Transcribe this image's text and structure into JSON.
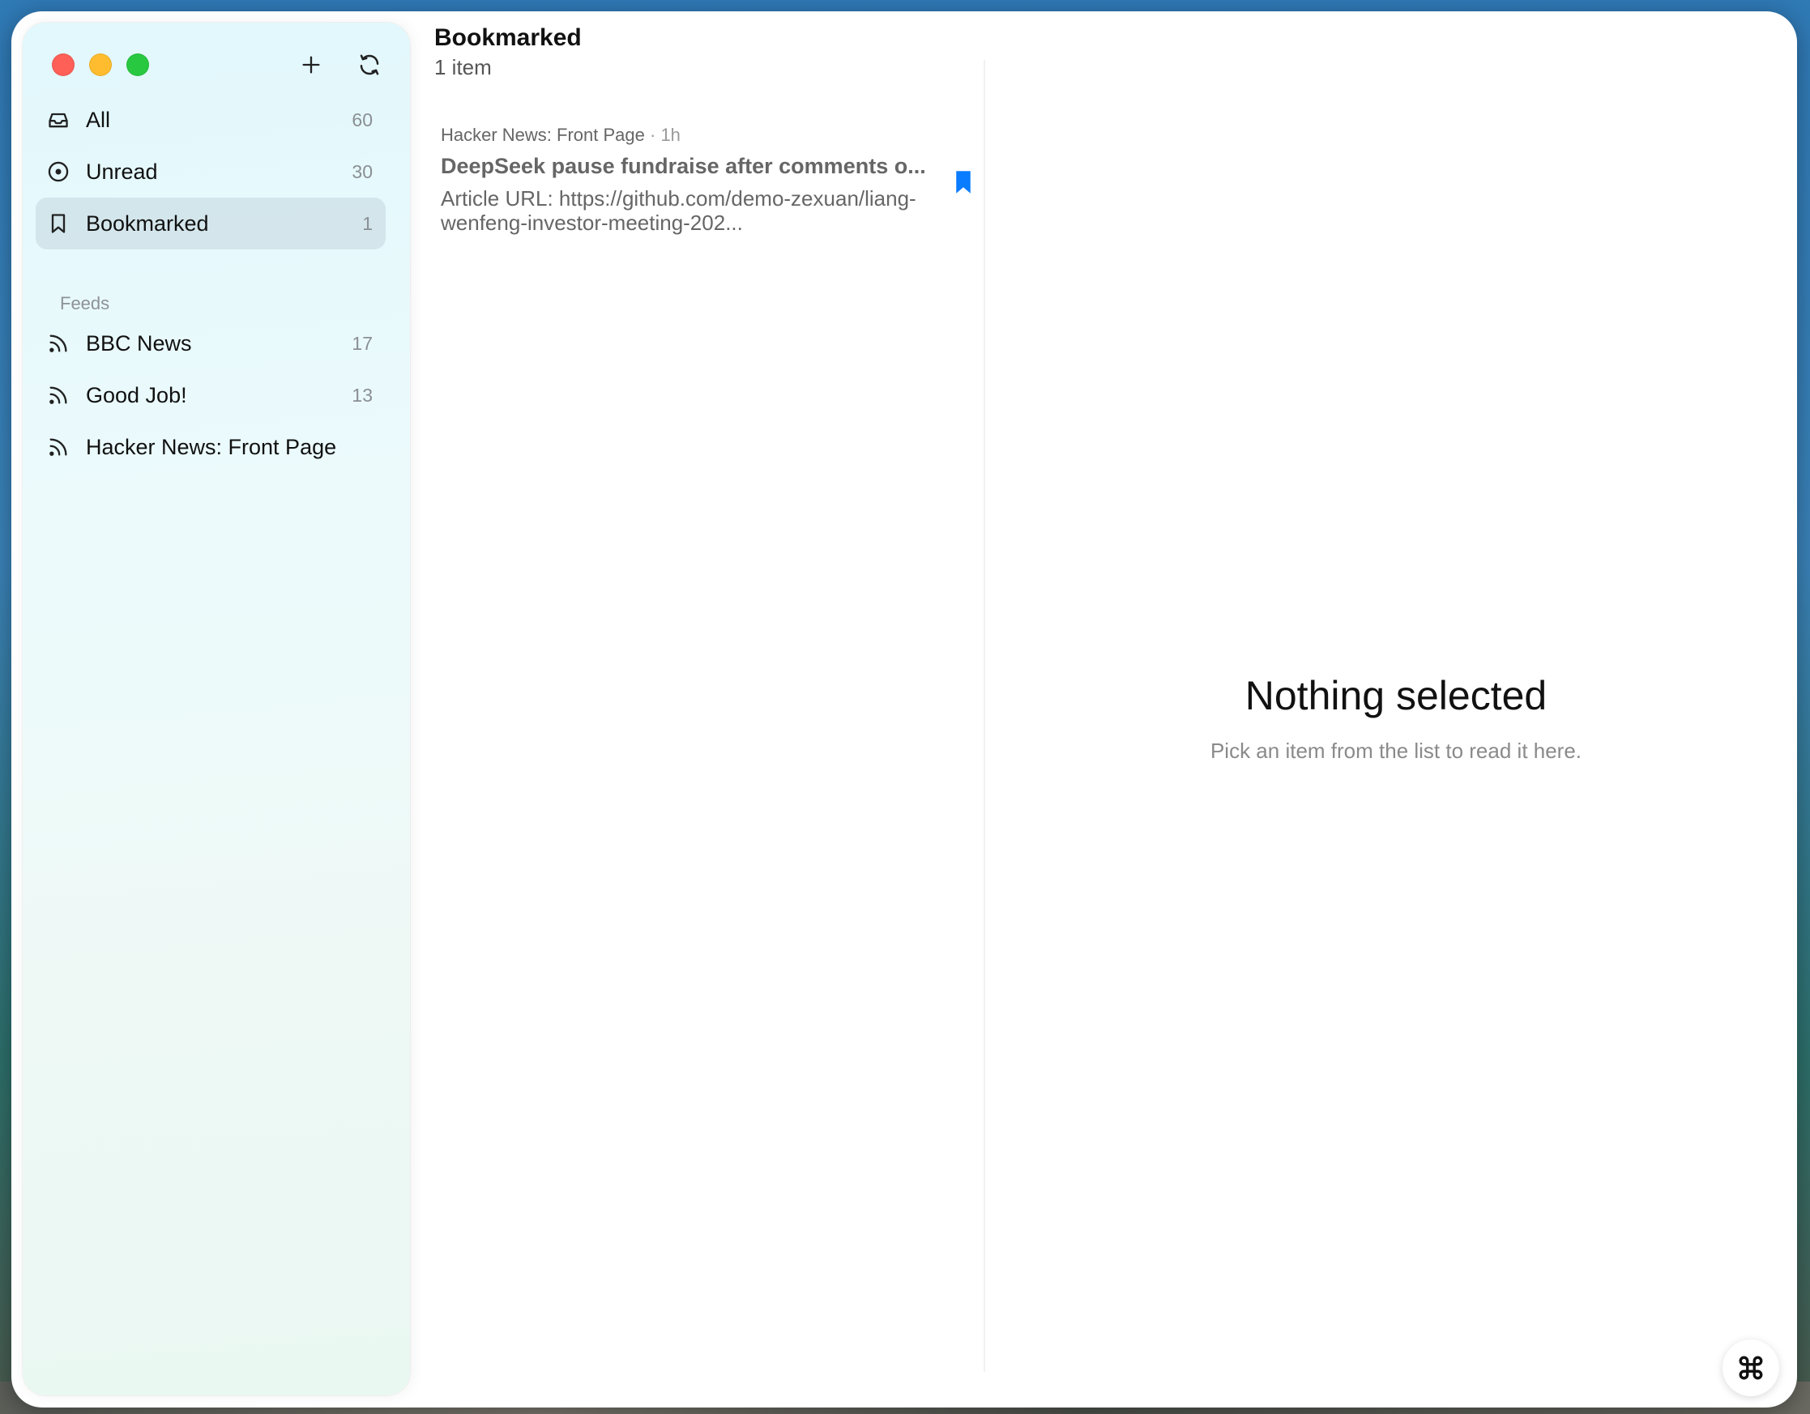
{
  "window": {
    "controls": [
      "close",
      "minimize",
      "zoom"
    ]
  },
  "sidebar": {
    "toolbar": {
      "add_icon": "plus-icon",
      "refresh_icon": "refresh-icon"
    },
    "items": [
      {
        "label": "All",
        "count": "60",
        "icon": "inbox-icon"
      },
      {
        "label": "Unread",
        "count": "30",
        "icon": "unread-circle-icon"
      },
      {
        "label": "Bookmarked",
        "count": "1",
        "icon": "bookmark-icon",
        "active": true
      }
    ],
    "section_label": "Feeds",
    "feeds": [
      {
        "label": "BBC News",
        "count": "17",
        "icon": "rss-icon"
      },
      {
        "label": "Good Job!",
        "count": "13",
        "icon": "rss-icon"
      },
      {
        "label": "Hacker News: Front Page",
        "count": "",
        "icon": "rss-icon"
      }
    ]
  },
  "list": {
    "title": "Bookmarked",
    "subtitle": "1 item",
    "articles": [
      {
        "source": "Hacker News: Front Page",
        "time": "· 1h",
        "title": "DeepSeek pause fundraise after comments o...",
        "summary": "Article URL: https://github.com/demo-zexuan/liang-wenfeng-investor-meeting-202...",
        "bookmarked": true
      }
    ]
  },
  "reader": {
    "empty_title": "Nothing selected",
    "empty_subtitle": "Pick an item from the list to read it here."
  },
  "colors": {
    "accent": "#0a7cff",
    "close": "#fe5f57",
    "minimize": "#febc2e",
    "zoom": "#28c840"
  },
  "floating_button": {
    "icon": "command-icon"
  }
}
